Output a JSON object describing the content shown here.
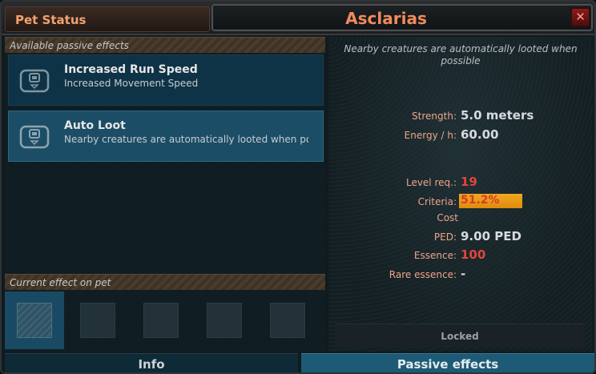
{
  "window": {
    "tab_label": "Pet Status",
    "pet_name": "Asclarias",
    "close_glyph": "✕"
  },
  "available_section": {
    "header": "Available passive effects",
    "effects": [
      {
        "title": "Increased Run Speed",
        "description": "Increased Movement Speed",
        "icon": "tag-icon",
        "selected": false
      },
      {
        "title": "Auto Loot",
        "description": "Nearby creatures are automatically looted when possible",
        "icon": "tag-icon",
        "selected": true
      }
    ]
  },
  "current_section": {
    "header": "Current effect on pet",
    "slots": [
      {
        "active": true
      },
      {
        "active": false
      },
      {
        "active": false
      },
      {
        "active": false
      },
      {
        "active": false
      }
    ]
  },
  "details": {
    "summary": "Nearby creatures are automatically looted when possible",
    "stats": [
      {
        "label": "Strength:",
        "value": "5.0 meters",
        "red": false
      },
      {
        "label": "Energy / h:",
        "value": "60.00",
        "red": false
      }
    ],
    "requirements": {
      "level_label": "Level req.:",
      "level_value": "19",
      "criteria_label": "Criteria:",
      "criteria_value": "51.2%",
      "criteria_fraction": 0.512
    },
    "cost": {
      "header": "Cost",
      "ped_label": "PED:",
      "ped_value": "9.00 PED",
      "essence_label": "Essence:",
      "essence_value": "100",
      "rare_label": "Rare essence:",
      "rare_value": "-"
    },
    "locked_label": "Locked"
  },
  "tabs": {
    "info": "Info",
    "passive": "Passive effects"
  },
  "colors": {
    "accent_orange": "#f08a5d",
    "label_salmon": "#f0a48a",
    "value_red": "#e3453c",
    "criteria_bar": "#f2a81f",
    "selected_row": "#1b4d66"
  }
}
